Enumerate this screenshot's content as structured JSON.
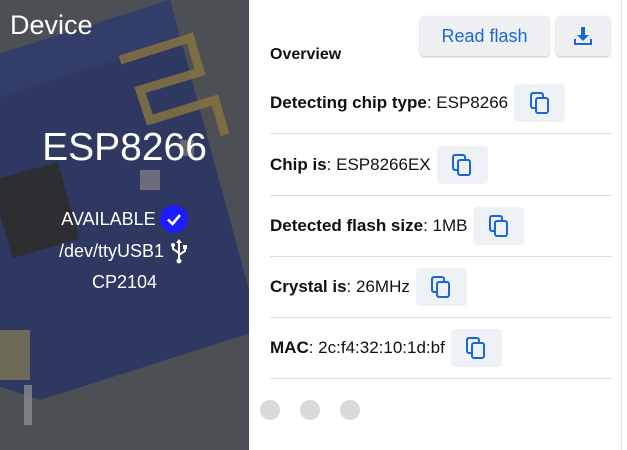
{
  "device": {
    "title": "Device",
    "chip_name": "ESP8266",
    "status": "AVAILABLE",
    "port": "/dev/ttyUSB1",
    "bridge": "CP2104"
  },
  "toolbar": {
    "read_flash_label": "Read flash"
  },
  "overview": {
    "heading": "Overview",
    "rows": [
      {
        "label": "Detecting chip type",
        "value": "ESP8266"
      },
      {
        "label": "Chip is",
        "value": "ESP8266EX"
      },
      {
        "label": "Detected flash size",
        "value": "1MB"
      },
      {
        "label": "Crystal is",
        "value": "26MHz"
      },
      {
        "label": "MAC",
        "value": "2c:f4:32:10:1d:bf"
      }
    ]
  },
  "icons": {
    "status": "check-circle-icon",
    "port": "usb-icon",
    "download": "download-icon",
    "copy": "copy-icon"
  },
  "colors": {
    "accent": "#1a66d9",
    "status_badge": "#1c1cff"
  }
}
